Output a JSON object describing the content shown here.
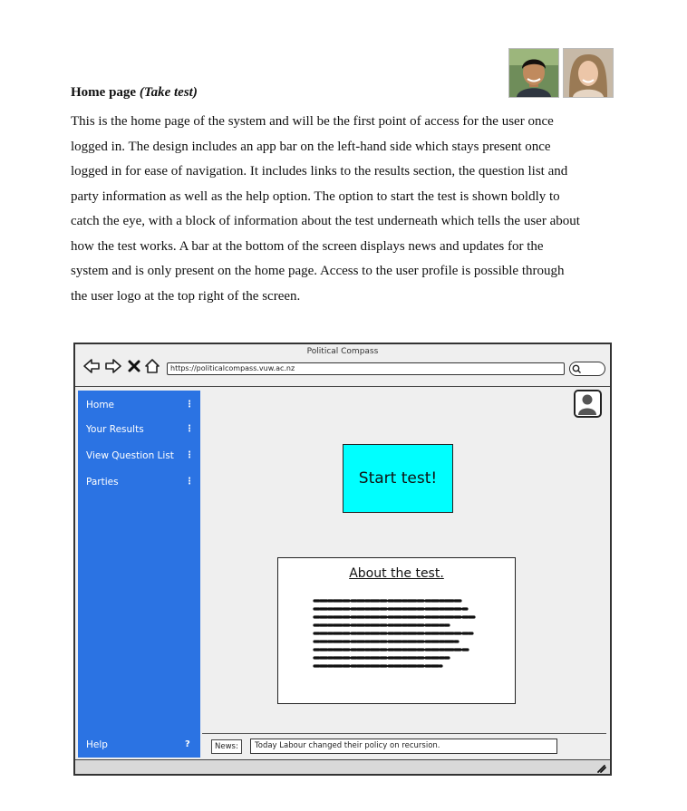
{
  "document": {
    "heading": "Home page",
    "heading_italic": "(Take test)",
    "paragraph_lines": [
      "This is the home page of the system and will be the first point of access for the user once",
      "logged in. The design includes an app bar on the left-hand side which stays present once",
      "logged in for ease of navigation. It includes links to the results section, the question list and",
      "party information as well as the help option. The option to start the test is shown boldly to",
      "catch the eye, with a block of information about the test underneath which tells the user about",
      "how the test works. A bar at the bottom of the screen displays news and updates for the",
      "system and is only present on the home page. Access to the user profile is possible through",
      "the user logo at the top right of the screen."
    ]
  },
  "mockup": {
    "window_title": "Political Compass",
    "url": "https://politicalcompass.vuw.ac.nz",
    "sidebar": {
      "items": [
        {
          "label": "Home",
          "marker": "⋮"
        },
        {
          "label": "Your Results",
          "marker": "⋮"
        },
        {
          "label": "View Question List",
          "marker": "⋮"
        },
        {
          "label": "Parties",
          "marker": "⋮"
        }
      ],
      "help": {
        "label": "Help",
        "marker": "?"
      }
    },
    "start_button": "Start test!",
    "about_title": "About the test.",
    "news_label": "News:",
    "news_text": "Today Labour changed their policy on recursion.",
    "colors": {
      "sidebar": "#2b73e3",
      "start_button": "#00ffff"
    }
  },
  "icons": [
    "back-arrow-icon",
    "forward-arrow-icon",
    "close-icon",
    "home-icon",
    "search-icon",
    "user-icon",
    "resize-icon"
  ]
}
